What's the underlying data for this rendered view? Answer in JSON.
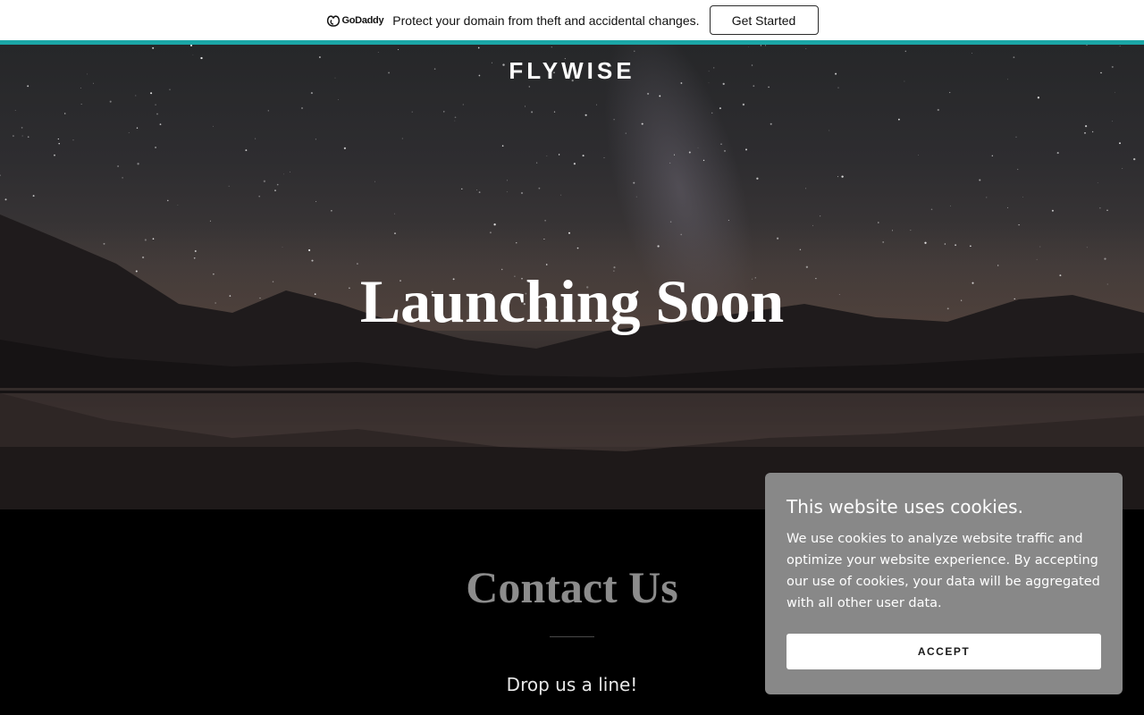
{
  "promo": {
    "logo_text": "GoDaddy",
    "message": "Protect your domain from theft and accidental changes.",
    "button_label": "Get Started"
  },
  "hero": {
    "brand": "FLYWISE",
    "title": "Launching Soon"
  },
  "contact": {
    "title": "Contact Us",
    "subtitle": "Drop us a line!"
  },
  "cookie": {
    "title": "This website uses cookies.",
    "body": "We use cookies to analyze website traffic and optimize your website experience. By accepting our use of cookies, your data will be aggregated with all other user data.",
    "accept_label": "ACCEPT"
  },
  "colors": {
    "accent_teal": "#1ba6a6",
    "cookie_panel": "#888888"
  }
}
